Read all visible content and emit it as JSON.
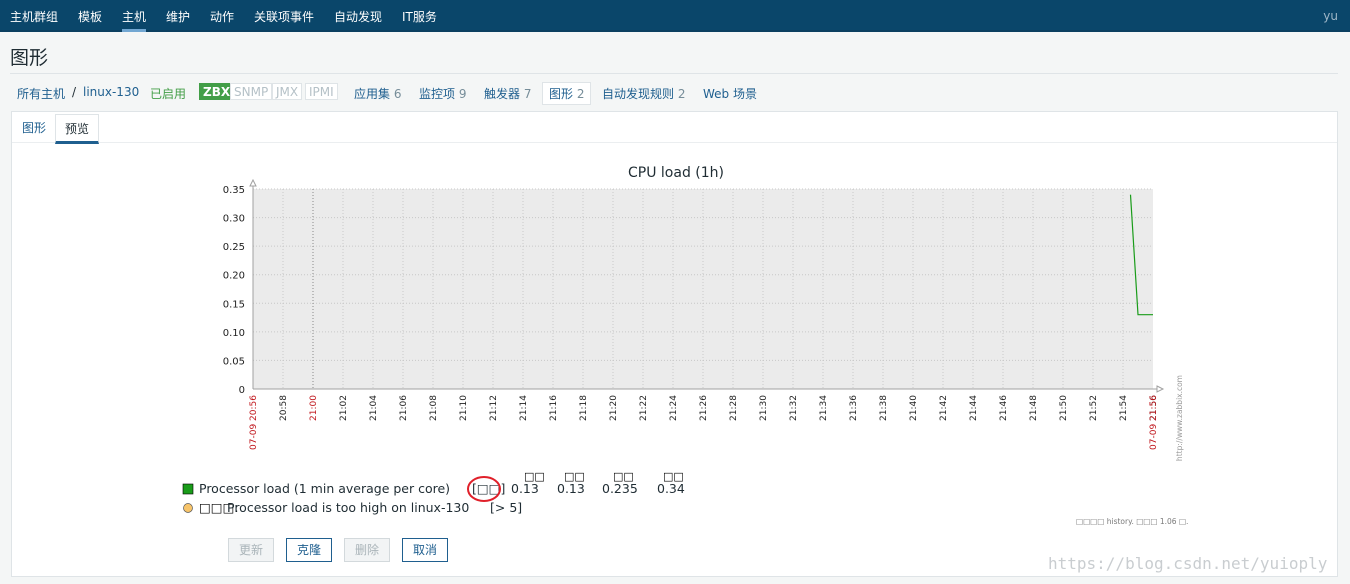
{
  "topnav": {
    "items": [
      "主机群组",
      "模板",
      "主机",
      "维护",
      "动作",
      "关联项事件",
      "自动发现",
      "IT服务"
    ],
    "active_index": 2,
    "user": "yu"
  },
  "page": {
    "title": "图形"
  },
  "breadcrumb": {
    "all_hosts": "所有主机",
    "separator": "/",
    "host": "linux-130",
    "status": "已启用",
    "availability": [
      {
        "label": "ZBX",
        "active": true
      },
      {
        "label": "SNMP",
        "active": false
      },
      {
        "label": "JMX",
        "active": false
      },
      {
        "label": "IPMI",
        "active": false
      }
    ],
    "links": [
      {
        "label": "应用集",
        "count": "6"
      },
      {
        "label": "监控项",
        "count": "9"
      },
      {
        "label": "触发器",
        "count": "7"
      },
      {
        "label": "图形",
        "count": "2"
      },
      {
        "label": "自动发现规则",
        "count": "2"
      },
      {
        "label": "Web 场景",
        "count": ""
      }
    ]
  },
  "tabs": [
    {
      "label": "图形"
    },
    {
      "label": "预览"
    }
  ],
  "selected_tab": 1,
  "chart_data": {
    "type": "line",
    "title": "CPU load (1h)",
    "xlabel": "",
    "ylabel": "",
    "ylim": [
      0,
      0.35
    ],
    "yticks": [
      "0",
      "0.05",
      "0.10",
      "0.15",
      "0.20",
      "0.25",
      "0.30",
      "0.35"
    ],
    "start_label": "07-09 20:56",
    "end_label": "07-09 21:56",
    "hour_label": "21:00",
    "xticks": [
      "20:58",
      "21:02",
      "21:04",
      "21:06",
      "21:08",
      "21:10",
      "21:12",
      "21:14",
      "21:16",
      "21:18",
      "21:20",
      "21:22",
      "21:24",
      "21:26",
      "21:28",
      "21:30",
      "21:32",
      "21:34",
      "21:36",
      "21:38",
      "21:40",
      "21:42",
      "21:44",
      "21:46",
      "21:48",
      "21:50",
      "21:52",
      "21:54",
      "21:56"
    ],
    "series": [
      {
        "name": "Processor load (1 min average per core)",
        "color": "#1a9c1a",
        "x": [
          "21:54:30",
          "21:55:00",
          "21:56:00"
        ],
        "values": [
          0.34,
          0.13,
          0.13
        ]
      }
    ],
    "grid": true,
    "watermark": "http://www.zabbix.com"
  },
  "legend": {
    "series_label": "Processor load (1 min average per core)",
    "func_box": "[□□]",
    "col_headers": [
      "□□",
      "□□",
      "□□",
      "□□"
    ],
    "stats": [
      "0.13",
      "0.13",
      "0.235",
      "0.34"
    ],
    "trigger_prefix": "□□□:",
    "trigger_label": "Processor load is too high on linux-130",
    "trigger_value": "[> 5]",
    "trigger_color": "#f7c46a",
    "series_color": "#1a9c1a",
    "footnote": "□□□□ history. □□□ 1.06 □."
  },
  "buttons": [
    {
      "label": "更新",
      "disabled": true
    },
    {
      "label": "克隆",
      "disabled": false
    },
    {
      "label": "删除",
      "disabled": true
    },
    {
      "label": "取消",
      "disabled": false
    }
  ],
  "watermark": "https://blog.csdn.net/yuioply"
}
